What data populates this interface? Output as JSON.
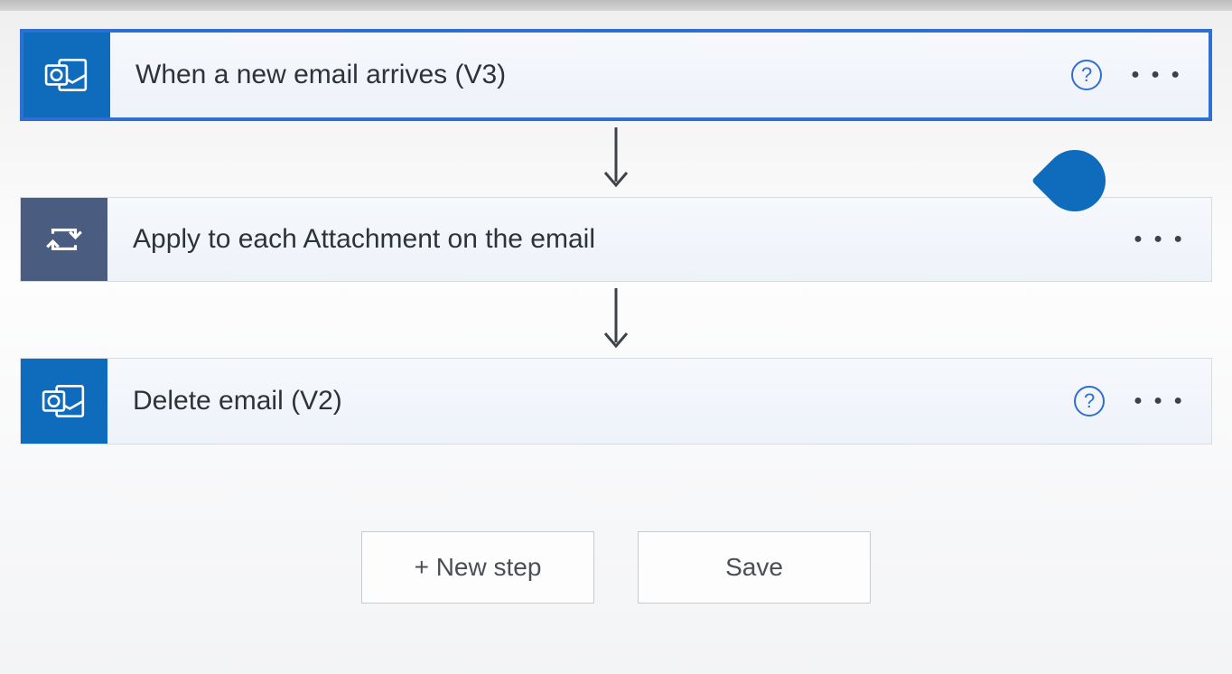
{
  "steps": [
    {
      "title": "When a new email arrives (V3)",
      "icon": "outlook",
      "selected": true,
      "has_help": true
    },
    {
      "title": "Apply to each Attachment on the email",
      "icon": "control-loop",
      "selected": false,
      "has_help": false
    },
    {
      "title": "Delete email (V2)",
      "icon": "outlook",
      "selected": false,
      "has_help": true
    }
  ],
  "buttons": {
    "new_step": "+ New step",
    "save": "Save"
  },
  "colors": {
    "accent": "#0f6cbd",
    "selection": "#2e6fd1",
    "control": "#4a5d80"
  }
}
